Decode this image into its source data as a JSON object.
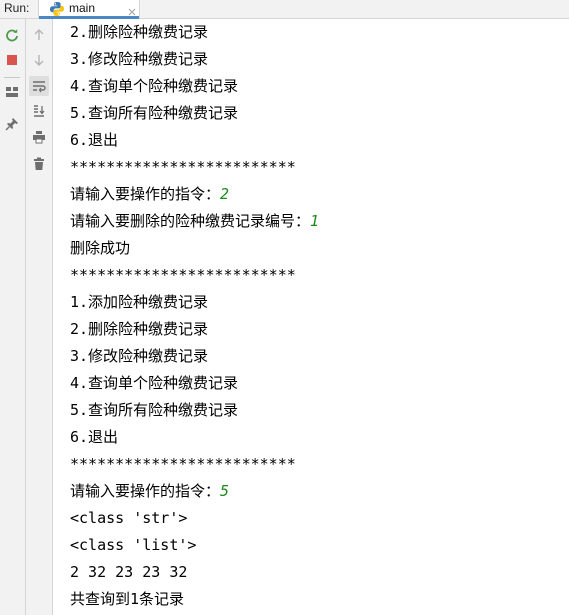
{
  "header": {
    "run_label": "Run:",
    "tab_label": "main"
  },
  "colors": {
    "input_text": "#1e8a1e",
    "rerun_icon": "#4c9a4c",
    "stop_icon": "#d9534f",
    "tab_underline": "#4a88c7"
  },
  "toolbar": {
    "left_icons": [
      "rerun-icon",
      "stop-icon",
      "layout-icon",
      "pin-icon"
    ],
    "right_icons": [
      "up-arrow-icon",
      "down-arrow-icon",
      "soft-wrap-icon",
      "scroll-to-end-icon",
      "print-icon",
      "trash-icon"
    ]
  },
  "console": {
    "lines": [
      {
        "text": "2.删除险种缴费记录",
        "input": ""
      },
      {
        "text": "3.修改险种缴费记录",
        "input": ""
      },
      {
        "text": "4.查询单个险种缴费记录",
        "input": ""
      },
      {
        "text": "5.查询所有险种缴费记录",
        "input": ""
      },
      {
        "text": "6.退出",
        "input": ""
      },
      {
        "text": "*************************",
        "input": ""
      },
      {
        "text": "请输入要操作的指令：",
        "input": "2"
      },
      {
        "text": "请输入要删除的险种缴费记录编号：",
        "input": "1"
      },
      {
        "text": "删除成功",
        "input": ""
      },
      {
        "text": "*************************",
        "input": ""
      },
      {
        "text": "1.添加险种缴费记录",
        "input": ""
      },
      {
        "text": "2.删除险种缴费记录",
        "input": ""
      },
      {
        "text": "3.修改险种缴费记录",
        "input": ""
      },
      {
        "text": "4.查询单个险种缴费记录",
        "input": ""
      },
      {
        "text": "5.查询所有险种缴费记录",
        "input": ""
      },
      {
        "text": "6.退出",
        "input": ""
      },
      {
        "text": "*************************",
        "input": ""
      },
      {
        "text": "请输入要操作的指令：",
        "input": "5"
      },
      {
        "text": "<class 'str'>",
        "input": ""
      },
      {
        "text": "<class 'list'>",
        "input": ""
      },
      {
        "text": "2 32 23 23 32",
        "input": ""
      },
      {
        "text": "共查询到1条记录",
        "input": ""
      }
    ]
  }
}
